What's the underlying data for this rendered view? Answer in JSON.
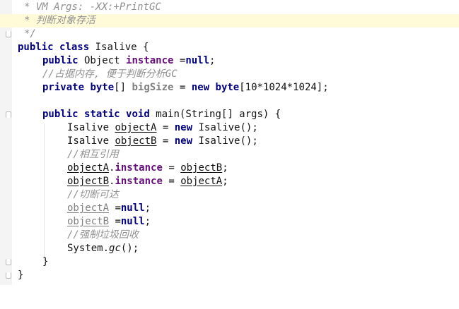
{
  "editor": {
    "language": "java",
    "colors": {
      "keyword": "#000080",
      "field": "#660e7a",
      "comment": "#909090",
      "highlight_line": "#fffbd9",
      "gutter": "#f4f4f4"
    },
    "comment_header": {
      "line1": "* VM Args: -XX:+PrintGC",
      "line2": "* 判断对象存活",
      "line3": "*/"
    },
    "class_decl": {
      "kw_public": "public",
      "kw_class": "class",
      "name": "Isalive",
      "brace": " {"
    },
    "field_instance": {
      "kw_public": "public",
      "type": " Object ",
      "name": "instance",
      "assign": " =",
      "kw_null": "null",
      "semi": ";"
    },
    "comment_bigsize": "//占据内存, 便于判断分析GC",
    "field_bigsize": {
      "kw_private": "private",
      "kw_byte": "byte",
      "brackets": "[] ",
      "name": "bigSize",
      "assign": " = ",
      "kw_new": "new",
      "sp": " ",
      "kw_byte2": "byte",
      "rest": "[10*1024*1024];"
    },
    "main_decl": {
      "kw_public": "public",
      "kw_static": "static",
      "kw_void": "void",
      "rest": " main(String[] args) {"
    },
    "stmt_a": {
      "type": "Isalive ",
      "var": "objectA",
      "eq": " = ",
      "kw_new": "new",
      "rest": " Isalive();"
    },
    "stmt_b": {
      "type": "Isalive ",
      "var": "objectB",
      "eq": " = ",
      "kw_new": "new",
      "rest": " Isalive();"
    },
    "comment_mutual": "//相互引用",
    "stmt_ab": {
      "left": "objectA",
      "dot": ".",
      "field": "instance",
      "eq": " = ",
      "right": "objectB",
      "semi": ";"
    },
    "stmt_ba": {
      "left": "objectB",
      "dot": ".",
      "field": "instance",
      "eq": " = ",
      "right": "objectA",
      "semi": ";"
    },
    "comment_cut": "//切断可达",
    "stmt_nulla": {
      "var": "objectA",
      "eq": " =",
      "kw_null": "null",
      "semi": ";"
    },
    "stmt_nullb": {
      "var": "objectB",
      "eq": " =",
      "kw_null": "null",
      "semi": ";"
    },
    "comment_gc": "//强制垃圾回收",
    "stmt_gc": {
      "obj": "System.",
      "method": "gc",
      "rest": "();"
    },
    "close_method": "}",
    "close_class": "}"
  }
}
